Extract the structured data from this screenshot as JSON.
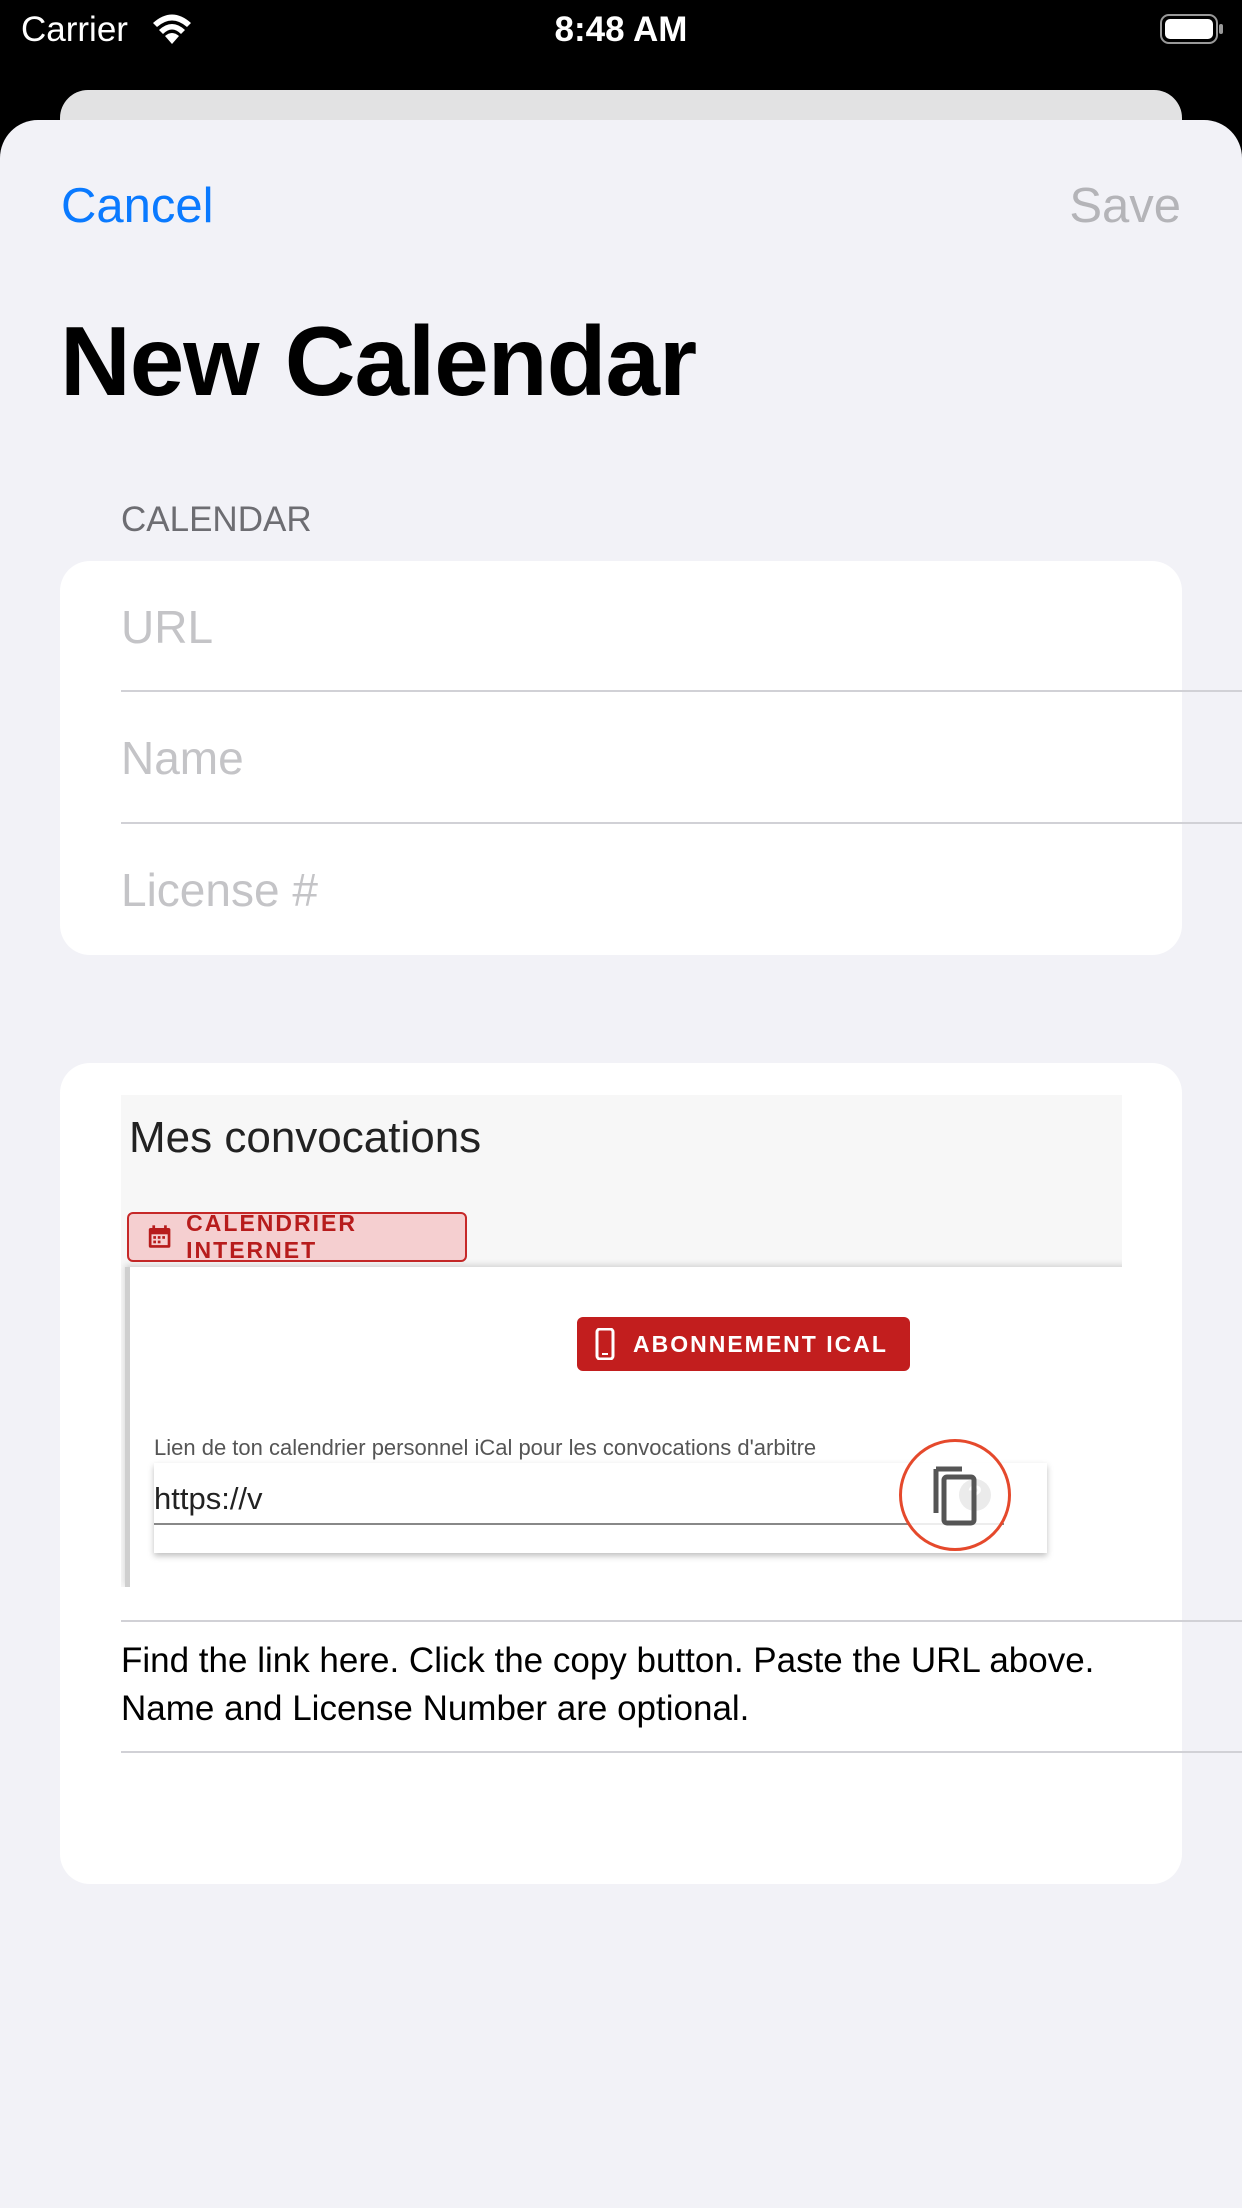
{
  "status_bar": {
    "carrier": "Carrier",
    "time": "8:48 AM"
  },
  "nav": {
    "cancel_label": "Cancel",
    "save_label": "Save"
  },
  "page_title": "New Calendar",
  "section_header": "CALENDAR",
  "fields": {
    "url_placeholder": "URL",
    "name_placeholder": "Name",
    "license_placeholder": "License #"
  },
  "instruction_image": {
    "heading": "Mes convocations",
    "tab_label": "CALENDRIER INTERNET",
    "button_label": "ABONNEMENT ICAL",
    "link_description": "Lien de ton calendrier personnel iCal pour les convocations d'arbitre",
    "link_value": "https://v",
    "help_glyph": "?",
    "highlight_color": "#e5492c",
    "accent_color": "#c21e1e"
  },
  "help_text": "Find the link here. Click the copy button. Paste the URL above. Name and License Number are optional.",
  "colors": {
    "tint": "#0a7aff",
    "disabled": "#b4b4b8",
    "background": "#f2f2f7"
  }
}
